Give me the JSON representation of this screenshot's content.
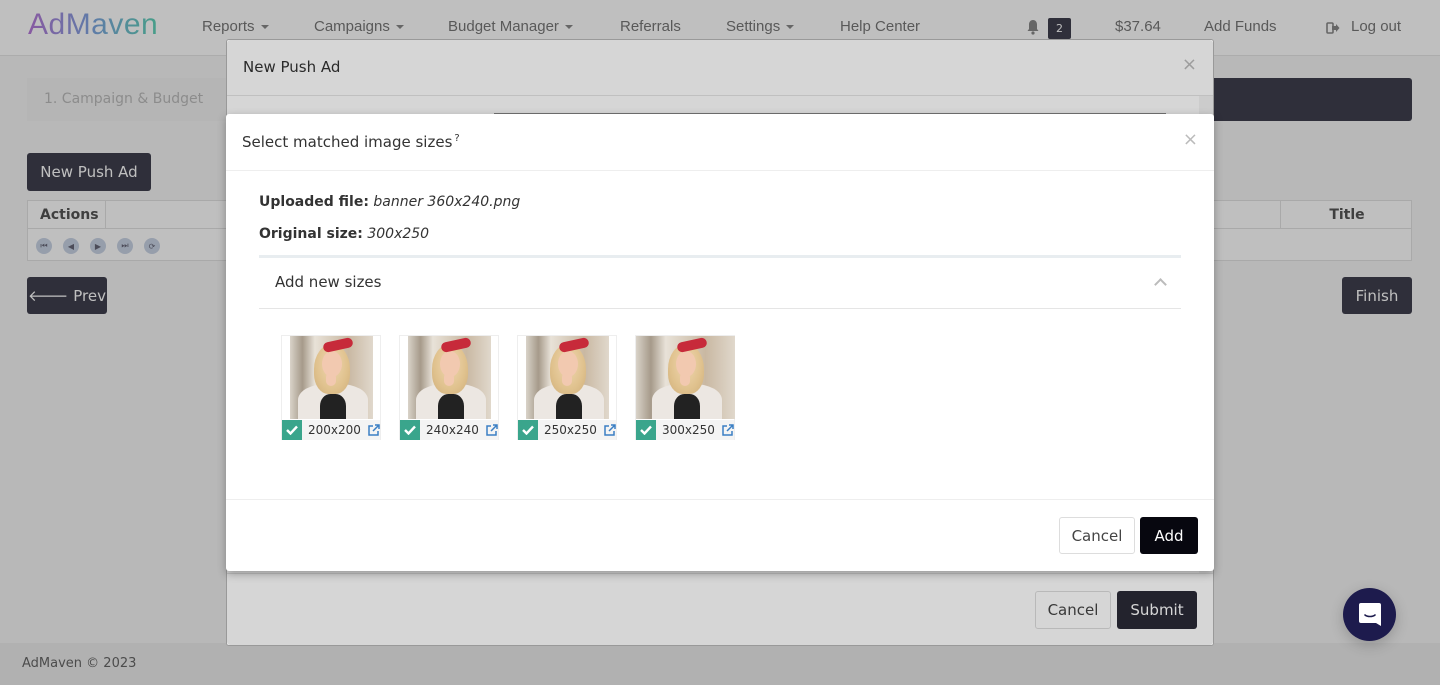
{
  "navbar": {
    "logo": "AdMaven",
    "items": [
      {
        "label": "Reports",
        "dropdown": true
      },
      {
        "label": "Campaigns",
        "dropdown": true
      },
      {
        "label": "Budget Manager",
        "dropdown": true
      },
      {
        "label": "Referrals",
        "dropdown": false
      },
      {
        "label": "Settings",
        "dropdown": true
      },
      {
        "label": "Help Center",
        "dropdown": false
      }
    ],
    "notifications_count": "2",
    "balance": "$37.64",
    "add_funds": "Add Funds",
    "logout": "Log out"
  },
  "page": {
    "step_1": "1. Campaign & Budget",
    "new_push_ad_button": "New Push Ad",
    "table": {
      "columns": [
        "Actions",
        "Title"
      ]
    },
    "prev_button": "Prev",
    "finish_button": "Finish"
  },
  "outer_modal": {
    "title": "New Push Ad",
    "cancel_button": "Cancel",
    "submit_button": "Submit"
  },
  "inner_modal": {
    "title": "Select matched image sizes",
    "help_mark": "?",
    "uploaded_file_label": "Uploaded file:",
    "uploaded_file_value": "banner 360x240.png",
    "original_size_label": "Original size:",
    "original_size_value": "300x250",
    "panel_title": "Add new sizes",
    "sizes": [
      {
        "size": "200x200",
        "checked": true
      },
      {
        "size": "240x240",
        "checked": true
      },
      {
        "size": "250x250",
        "checked": true
      },
      {
        "size": "300x250",
        "checked": true
      }
    ],
    "cancel_button": "Cancel",
    "add_button": "Add"
  },
  "footer": {
    "copyright": "AdMaven © 2023"
  },
  "colors": {
    "dark_button": "#3f3f4e",
    "add_button": "#07070f",
    "checkbox_green": "#3aa58c",
    "chat_fab": "#1d1b4d",
    "link_blue": "#3b7fc4"
  }
}
